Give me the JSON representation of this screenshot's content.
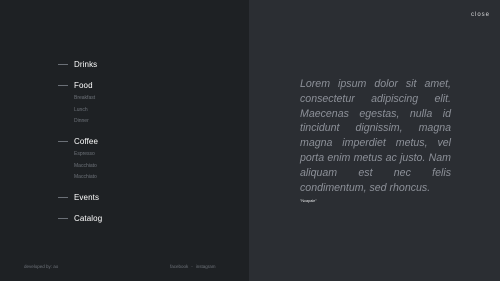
{
  "menu": {
    "drinks": {
      "label": "Drinks"
    },
    "food": {
      "label": "Food",
      "items": [
        "Breakfast",
        "Lunch",
        "Dinner"
      ]
    },
    "coffee": {
      "label": "Coffee",
      "items": [
        "Espresso",
        "Macchiato",
        "Macchiato"
      ]
    },
    "events": {
      "label": "Events"
    },
    "catalog": {
      "label": "Catalog"
    }
  },
  "footer": {
    "developed": "developed by: ao",
    "facebook": "facebook",
    "separator": "-",
    "instagram": "instagram"
  },
  "close_label": "close",
  "quote": {
    "text": "Lorem ipsum dolor sit amet, consectetur adipiscing elit. Maecenas egestas, nulla id tincidunt dignissim, magna magna imperdiet metus, vel porta enim metus ac justo. Nam aliquam est nec felis condimentum, sed rhoncus.",
    "attribution": "\"Ncapale\""
  }
}
